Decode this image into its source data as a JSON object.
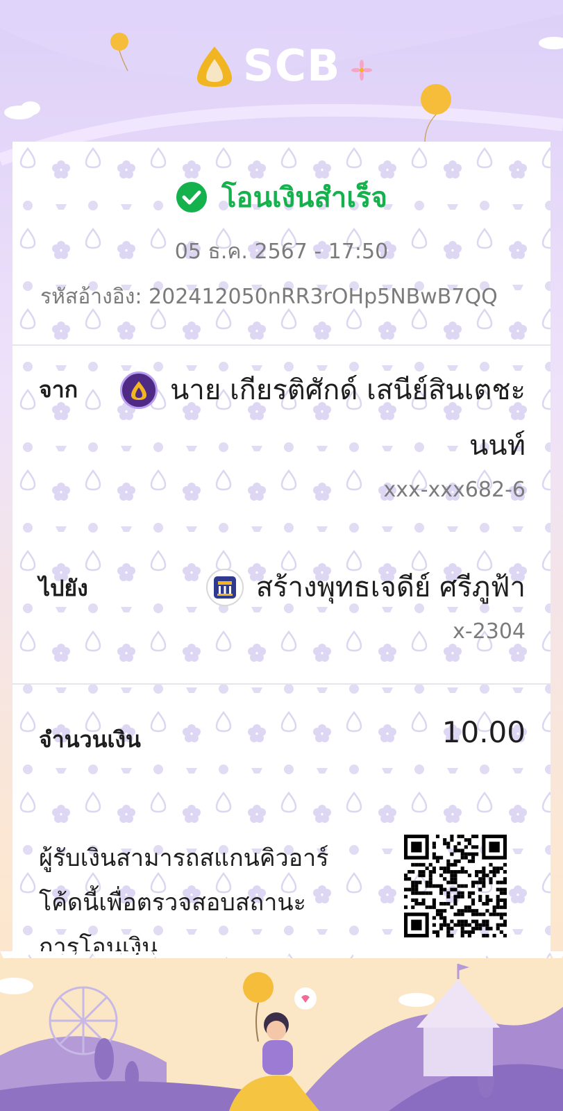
{
  "brand": {
    "name": "SCB"
  },
  "status": {
    "text": "โอนเงินสำเร็จ"
  },
  "transaction": {
    "datetime": "05 ธ.ค. 2567 - 17:50",
    "reference": "รหัสอ้างอิง: 202412050nRR3rOHp5NBwB7QQ"
  },
  "from": {
    "label": "จาก",
    "name_line1": "นาย เกียรติศักด์ เสนีย์สินเตชะ",
    "name_line2": "นนท์",
    "account": "xxx-xxx682-6",
    "bank_icon": "scb-bank-icon"
  },
  "to": {
    "label": "ไปยัง",
    "name": "สร้างพุทธเจดีย์ ศรีภูฟ้า",
    "account": "x-2304",
    "bank_icon": "gsb-bank-icon"
  },
  "amount": {
    "label": "จำนวนเงิน",
    "value": "10.00"
  },
  "qr": {
    "text_line1": "ผู้รับเงินสามารถสแกนคิวอาร์",
    "text_line2": "โค้ดนี้เพื่อตรวจสอบสถานะ",
    "text_line3": "การโอนเงิน"
  },
  "colors": {
    "success": "#14b14d",
    "brand_purple": "#4e2a84",
    "brand_gold": "#f2b522"
  }
}
